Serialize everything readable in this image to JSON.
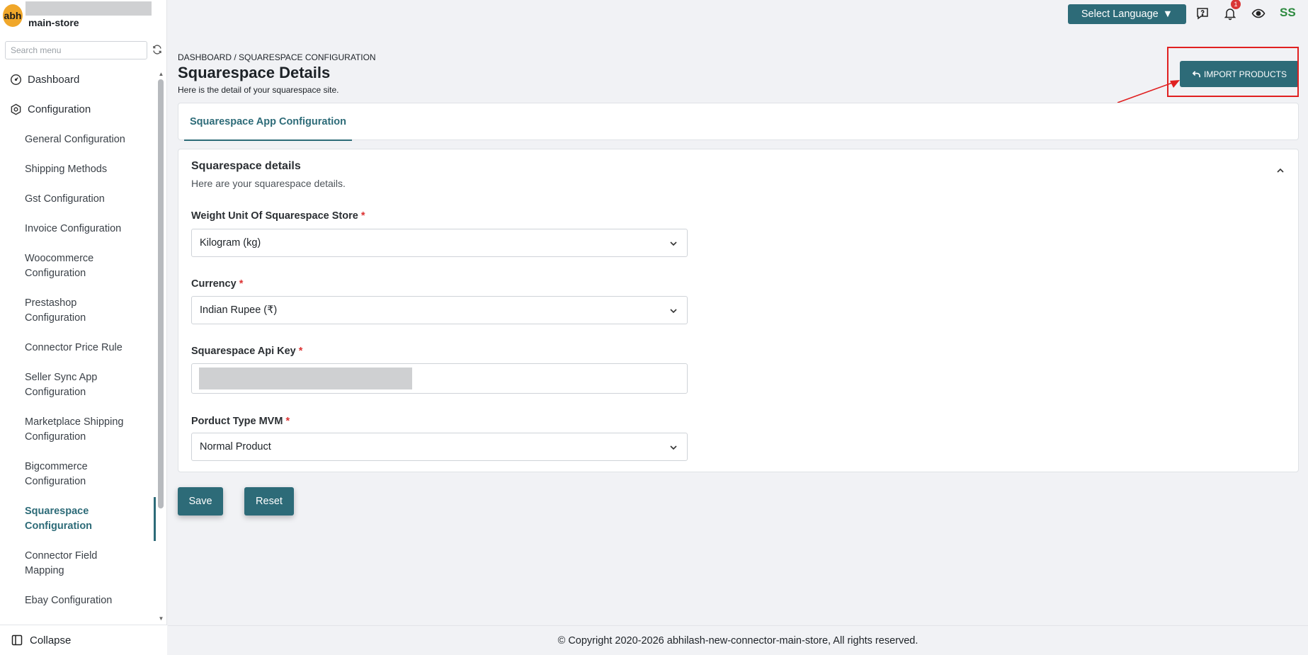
{
  "sidebar": {
    "logo_text": "abh",
    "store_name": "main-store",
    "search_placeholder": "Search menu",
    "menu": {
      "dashboard": "Dashboard",
      "configuration": "Configuration",
      "items": [
        "General Configuration",
        "Shipping Methods",
        "Gst Configuration",
        "Invoice Configuration",
        "Woocommerce Configuration",
        "Prestashop Configuration",
        "Connector Price Rule",
        "Seller Sync App Configuration",
        "Marketplace Shipping Configuration",
        "Bigcommerce Configuration",
        "Squarespace Configuration",
        "Connector Field Mapping",
        "Ebay Configuration"
      ],
      "active_item": "Squarespace Configuration"
    },
    "collapse_label": "Collapse"
  },
  "topbar": {
    "language_label": "Select Language",
    "notification_count": "1",
    "avatar_initials": "SS"
  },
  "header": {
    "breadcrumb": "DASHBOARD / SQUARESPACE CONFIGURATION",
    "title": "Squarespace Details",
    "subtitle": "Here is the detail of your squarespace site.",
    "import_button": "IMPORT PRODUCTS"
  },
  "tabs": {
    "active": "Squarespace App Configuration"
  },
  "details": {
    "title": "Squarespace details",
    "subtitle": "Here are your squarespace details.",
    "fields": {
      "weight_label": "Weight Unit Of Squarespace Store",
      "weight_value": "Kilogram (kg)",
      "currency_label": "Currency",
      "currency_value": "Indian Rupee (₹)",
      "api_key_label": "Squarespace Api Key",
      "product_type_label": "Porduct Type MVM",
      "product_type_value": "Normal Product"
    },
    "required_mark": "*"
  },
  "actions": {
    "save": "Save",
    "reset": "Reset"
  },
  "footer": {
    "copyright": "© Copyright 2020-2026 abhilash-new-connector-main-store, All rights reserved."
  },
  "colors": {
    "accent": "#2d6b78",
    "annotation": "#e02020",
    "badge": "#d93636"
  }
}
